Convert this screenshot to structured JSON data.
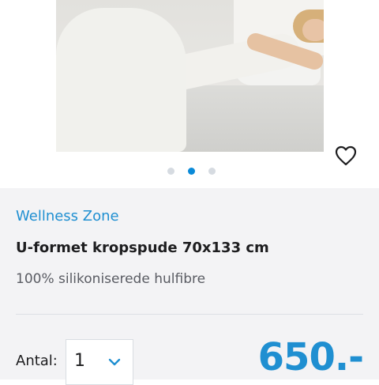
{
  "product": {
    "brand": "Wellness Zone",
    "title": "U-formet kropspude 70x133 cm",
    "subtitle": "100% silikoniserede hulfibre",
    "price": "650.-"
  },
  "gallery": {
    "image_count": 3,
    "active_index": 1,
    "icons": {
      "wishlist": "heart-icon"
    }
  },
  "purchase": {
    "quantity_label": "Antal:",
    "quantity_value": "1",
    "quantity_icon": "chevron-down-icon"
  },
  "colors": {
    "accent": "#1f8fd1",
    "active_dot": "#0a8ad8",
    "inactive_dot": "#d6dbe1",
    "panel_background": "#f3f3f5"
  }
}
